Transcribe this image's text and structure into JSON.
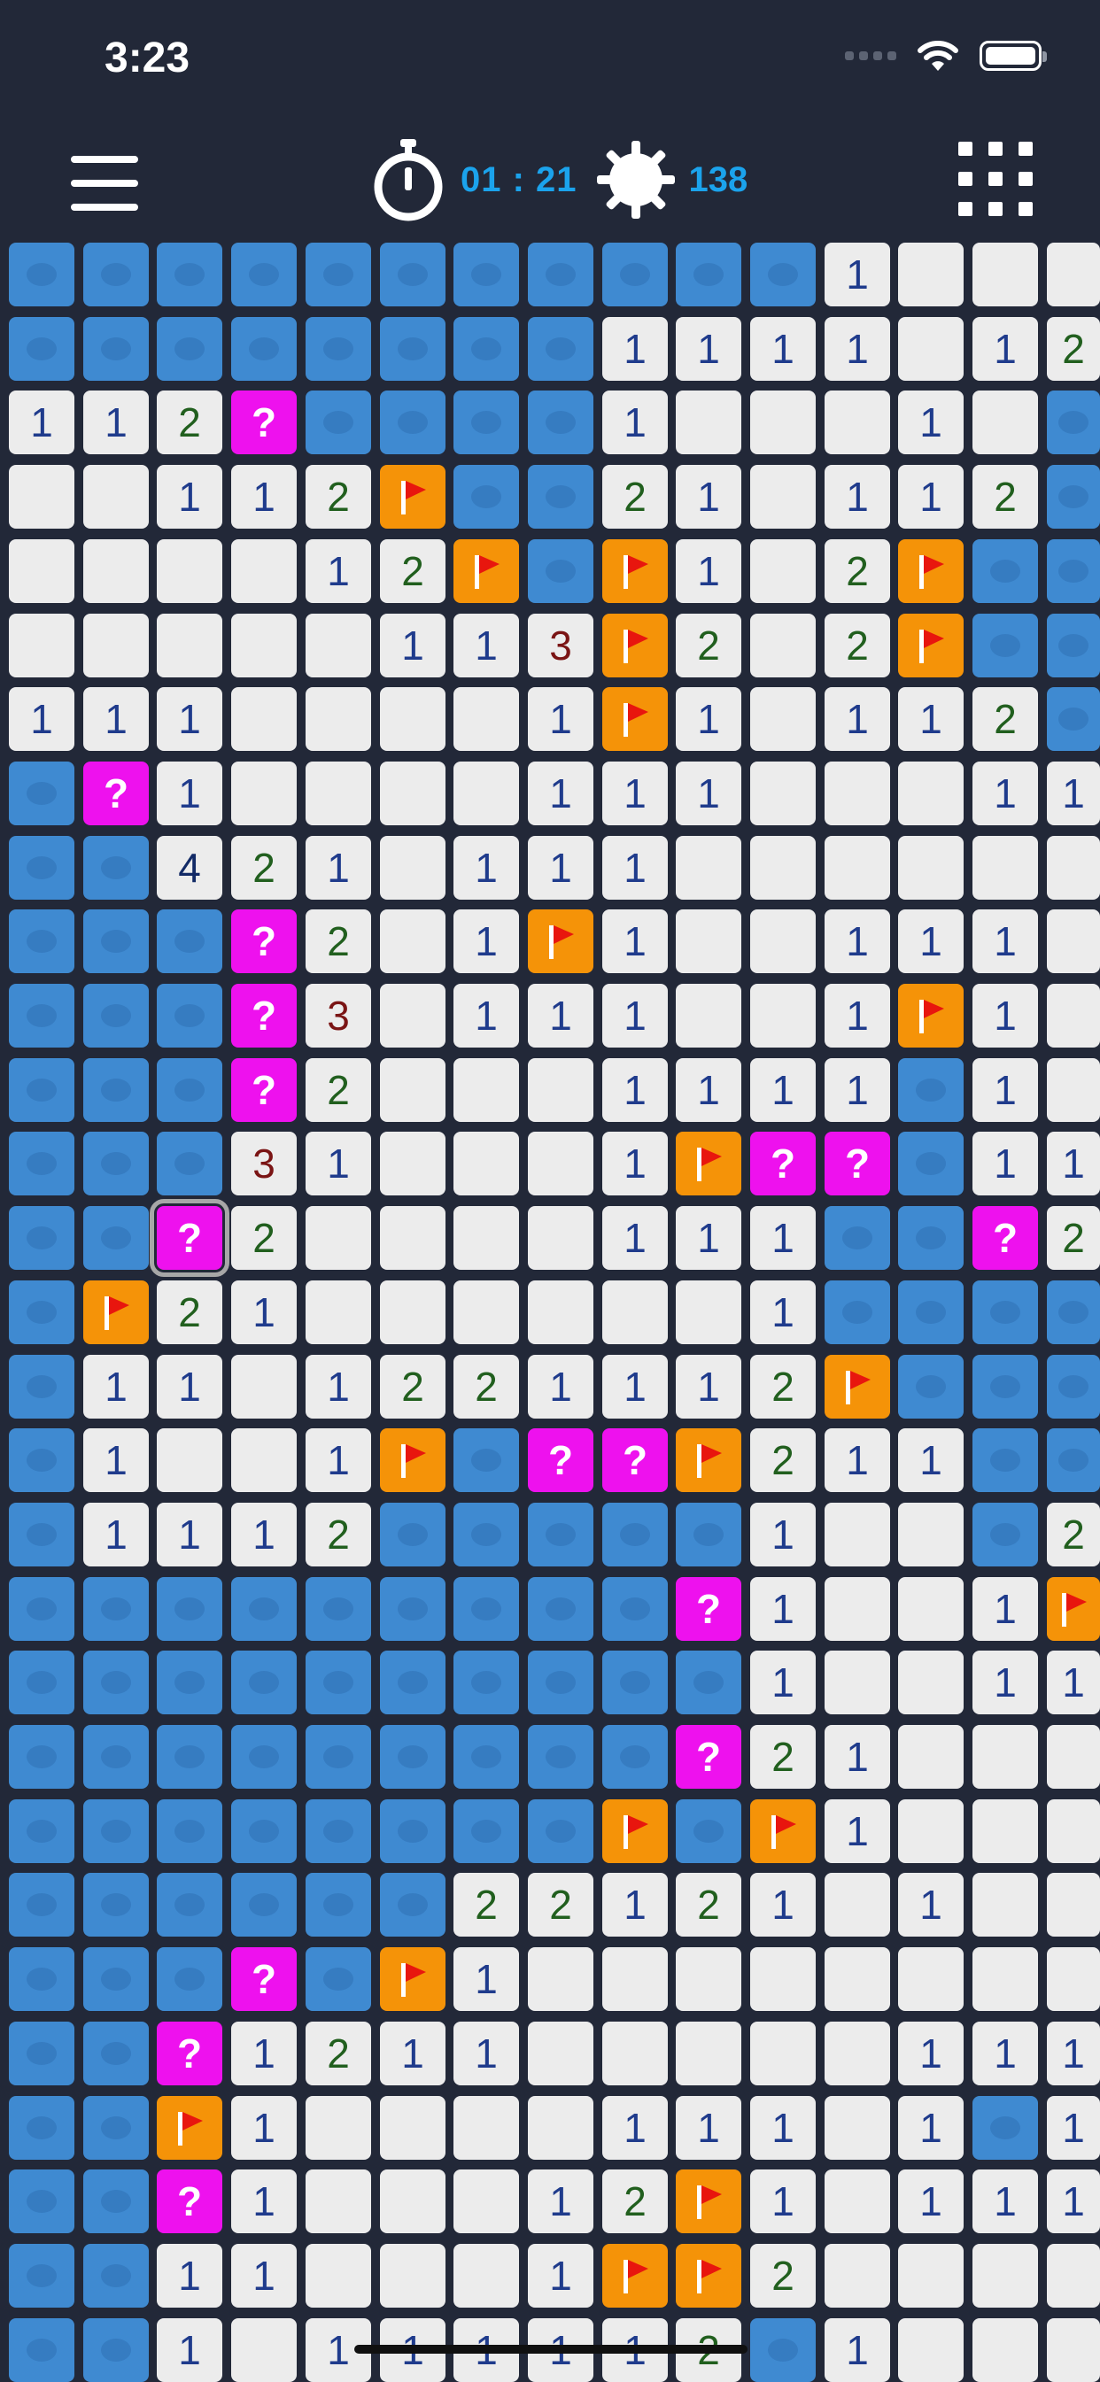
{
  "status_bar": {
    "time": "3:23",
    "icons": [
      "signal-icon",
      "wifi-icon",
      "battery-icon"
    ]
  },
  "toolbar": {
    "menu_icon": "hamburger-menu-icon",
    "timer_icon": "stopwatch-icon",
    "timer": "01 : 21",
    "mines_icon": "mine-icon",
    "mines_remaining": "138",
    "board_size_icon": "grid-dots-icon"
  },
  "colors": {
    "background": "#222838",
    "hidden_cell": "#3f8ad1",
    "open_cell": "#ececec",
    "flag_cell": "#f59308",
    "question_cell": "#ee11ee",
    "accent": "#1ba3ec"
  },
  "legend": {
    "#": "hidden",
    ".": "open empty",
    "1-9": "open number",
    "F": "flag",
    "?": "question mark"
  },
  "selected_cell": {
    "row": 13,
    "col": 2
  },
  "board": [
    "###########1...",
    "########1111.12",
    "112?####1...1.#",
    "..112F##21.112#",
    "....12F#F1.2F##",
    ".....113F2.2F##",
    "111....1F1.112#",
    "#?1....111...11",
    "##421.111......",
    "###?2.1F1..111.",
    "###?3.111..1F1.",
    "###?2...1111#1.",
    "###31...1F??#11",
    "##?2....111##?2",
    "#F21......1####",
    "#11.1221112F###",
    "#1..1F#??F211##",
    "#1112#####1..#2",
    "#########?1..1F1",
    "##########1..111",
    "#########?21...",
    "########F#F1...",
    "######22121.1..",
    "###?#F1........",
    "##?1211.....111",
    "##F1....111.1#1",
    "##?1...12F1.111",
    "##11...1FF2....",
    "##1.111112#1..."
  ]
}
